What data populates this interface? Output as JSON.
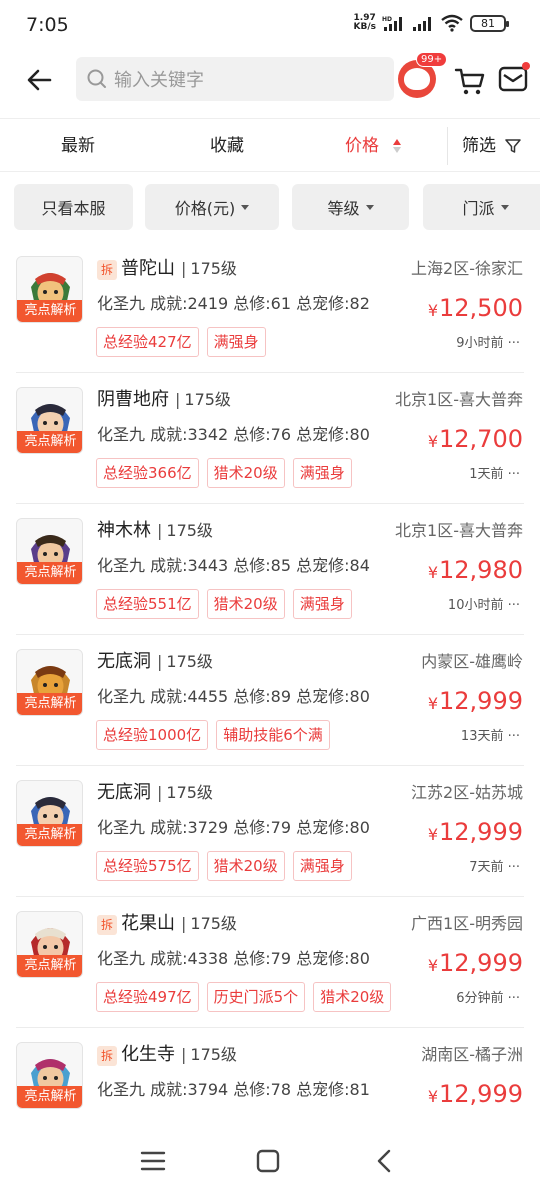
{
  "status_bar": {
    "time": "7:05",
    "net_speed_value": "1.97",
    "net_speed_unit": "KB/s",
    "hd": "HD",
    "battery": "81"
  },
  "header": {
    "search_placeholder": "输入关键字",
    "avatar_badge": "99+"
  },
  "sort_tabs": [
    {
      "label": "最新"
    },
    {
      "label": "收藏"
    },
    {
      "label": "价格"
    },
    {
      "label": "筛选"
    }
  ],
  "filter_chips": [
    {
      "label": "只看本服"
    },
    {
      "label": "价格(元)"
    },
    {
      "label": "等级"
    },
    {
      "label": "门派"
    }
  ],
  "thumb_tag": "亮点解析",
  "chai_label": "拆",
  "items": [
    {
      "sect": "普陀山",
      "level": "175级",
      "server": "上海2区-徐家汇",
      "stats": "化圣九 成就:2419 总修:61 总宠修:82",
      "price": "12,500",
      "currency": "¥",
      "time": "9小时前 ···",
      "tags": [
        "总经验427亿",
        "满强身"
      ],
      "chai": true
    },
    {
      "sect": "阴曹地府",
      "level": "175级",
      "server": "北京1区-喜大普奔",
      "stats": "化圣九 成就:3342 总修:76 总宠修:80",
      "price": "12,700",
      "currency": "¥",
      "time": "1天前 ···",
      "tags": [
        "总经验366亿",
        "猎术20级",
        "满强身"
      ],
      "chai": false
    },
    {
      "sect": "神木林",
      "level": "175级",
      "server": "北京1区-喜大普奔",
      "stats": "化圣九 成就:3443 总修:85 总宠修:84",
      "price": "12,980",
      "currency": "¥",
      "time": "10小时前 ···",
      "tags": [
        "总经验551亿",
        "猎术20级",
        "满强身"
      ],
      "chai": false
    },
    {
      "sect": "无底洞",
      "level": "175级",
      "server": "内蒙区-雄鹰岭",
      "stats": "化圣九 成就:4455 总修:89 总宠修:80",
      "price": "12,999",
      "currency": "¥",
      "time": "13天前 ···",
      "tags": [
        "总经验1000亿",
        "辅助技能6个满"
      ],
      "chai": false
    },
    {
      "sect": "无底洞",
      "level": "175级",
      "server": "江苏2区-姑苏城",
      "stats": "化圣九 成就:3729 总修:79 总宠修:80",
      "price": "12,999",
      "currency": "¥",
      "time": "7天前 ···",
      "tags": [
        "总经验575亿",
        "猎术20级",
        "满强身"
      ],
      "chai": false
    },
    {
      "sect": "花果山",
      "level": "175级",
      "server": "广西1区-明秀园",
      "stats": "化圣九 成就:4338 总修:79 总宠修:80",
      "price": "12,999",
      "currency": "¥",
      "time": "6分钟前 ···",
      "tags": [
        "总经验497亿",
        "历史门派5个",
        "猎术20级"
      ],
      "chai": true
    },
    {
      "sect": "化生寺",
      "level": "175级",
      "server": "湖南区-橘子洲",
      "stats": "化圣九 成就:3794 总修:78 总宠修:81",
      "price": "12,999",
      "currency": "¥",
      "time": "",
      "tags": [],
      "chai": true
    }
  ],
  "colors": {
    "accent": "#ea3c3c",
    "tag_orange": "#f2572f"
  }
}
